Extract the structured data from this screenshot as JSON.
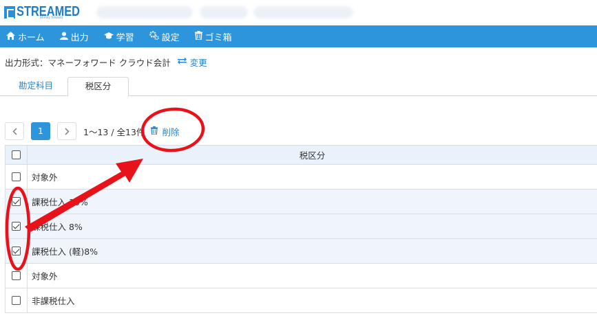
{
  "app": {
    "logo_text": "STREAMED",
    "logo_sub": "Money forward"
  },
  "nav": {
    "items": [
      {
        "label": "ホーム",
        "icon": "home-icon",
        "glyph": "⌂"
      },
      {
        "label": "出力",
        "icon": "user-icon",
        "glyph": "●"
      },
      {
        "label": "学習",
        "icon": "graduation-cap-icon",
        "glyph": "▲"
      },
      {
        "label": "設定",
        "icon": "gears-icon",
        "glyph": "✿"
      },
      {
        "label": "ゴミ箱",
        "icon": "trash-icon",
        "glyph": "▮"
      }
    ]
  },
  "output_format": {
    "text": "出力形式：マネーフォワード クラウド会計",
    "change_label": "変更",
    "change_icon": "exchange-icon"
  },
  "tabs": [
    {
      "label": "勘定科目",
      "active": false
    },
    {
      "label": "税区分",
      "active": true
    }
  ],
  "pagination": {
    "prev": "‹",
    "current": "1",
    "next": "›",
    "count_text": "1〜13 / 全13件",
    "delete_label": "削除",
    "delete_icon": "trash-icon"
  },
  "table": {
    "header": "税区分",
    "rows": [
      {
        "label": "対象外",
        "checked": false
      },
      {
        "label": "課税仕入 10%",
        "checked": true
      },
      {
        "label": "課税仕入 8%",
        "checked": true
      },
      {
        "label": "課税仕入 (軽)8%",
        "checked": true
      },
      {
        "label": "対象外",
        "checked": false
      },
      {
        "label": "非課税仕入",
        "checked": false
      }
    ]
  },
  "colors": {
    "brand": "#2d95db",
    "link": "#2d86cc",
    "annotation": "#e8121b"
  }
}
